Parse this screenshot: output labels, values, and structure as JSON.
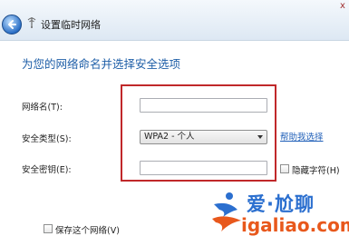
{
  "header": {
    "title": "设置临时网络",
    "back_icon": "back-arrow-icon",
    "network_icon": "wireless-network-icon",
    "close_label": "x"
  },
  "form": {
    "instruction": "为您的网络命名并选择安全选项",
    "network_name_label": "网络名(T):",
    "network_name_value": "",
    "security_type_label": "安全类型(S):",
    "security_type_value": "WPA2 - 个人",
    "help_link": "帮助我选择",
    "security_key_label": "安全密钥(E):",
    "security_key_value": "",
    "hide_chars_label": "隐藏字符(H)",
    "save_network_label": "保存这个网络(V)"
  },
  "watermark": {
    "text_cn": "爱·尬聊",
    "url": "igaliao.com"
  },
  "colors": {
    "highlight": "#c0282a",
    "instruction_text": "#1f5fa8",
    "link": "#1f5fb8",
    "watermark_blue": "#2b6fcf",
    "watermark_orange": "#e8581c"
  }
}
